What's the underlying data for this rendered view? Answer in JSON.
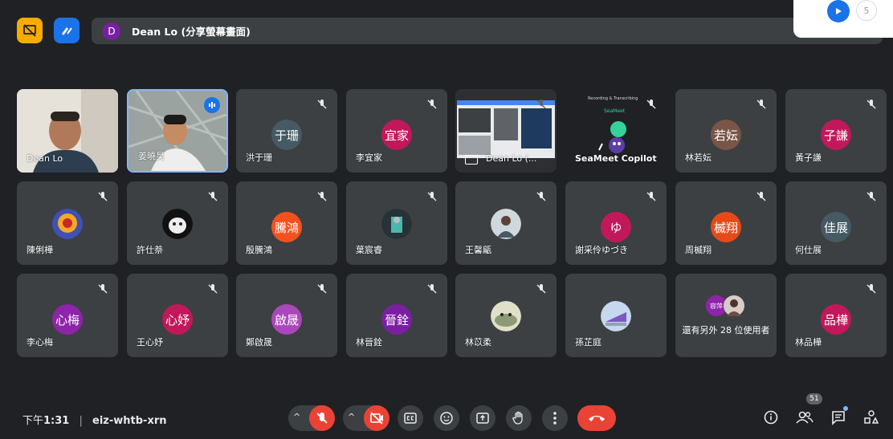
{
  "presenter": {
    "initial": "D",
    "label": "Dean Lo (分享螢幕畫面)"
  },
  "popup": {
    "alt_label": "5"
  },
  "tiles": [
    {
      "id": "dean-lo",
      "name": "Dean Lo"
    },
    {
      "id": "speaker",
      "name": "姜曉昊"
    },
    {
      "id": "t3",
      "name": "洪于珊",
      "initials": "于珊",
      "color": "#455a64"
    },
    {
      "id": "t4",
      "name": "李宜家",
      "initials": "宜家",
      "color": "#c2185b"
    },
    {
      "id": "t5",
      "name": "Dean Lo (..."
    },
    {
      "id": "t6",
      "name": "SeaMeet Copilot",
      "caption": "Recording & Transcribing",
      "brand": "SeaMeet"
    },
    {
      "id": "t7",
      "name": "林若妘",
      "initials": "若妘",
      "color": "#795548"
    },
    {
      "id": "t8",
      "name": "黃子謙",
      "initials": "子謙",
      "color": "#c2185b"
    },
    {
      "id": "t9",
      "name": "陳俐樺"
    },
    {
      "id": "t10",
      "name": "許仕萘"
    },
    {
      "id": "t11",
      "name": "殷騰鴻",
      "initials": "騰鴻",
      "color": "#f4511e"
    },
    {
      "id": "t12",
      "name": "葉宸睿"
    },
    {
      "id": "t13",
      "name": "王馨甂"
    },
    {
      "id": "t14",
      "name": "謝采伶ゆづき",
      "initials": "ゆ",
      "color": "#c2185b"
    },
    {
      "id": "t15",
      "name": "周楲翔",
      "initials": "楲翔",
      "color": "#e64a19"
    },
    {
      "id": "t16",
      "name": "何仕展",
      "initials": "佳展",
      "color": "#455a64"
    },
    {
      "id": "t17",
      "name": "李心梅",
      "initials": "心梅",
      "color": "#8e24aa"
    },
    {
      "id": "t18",
      "name": "王心妤",
      "initials": "心妤",
      "color": "#c2185b"
    },
    {
      "id": "t19",
      "name": "鄭啟晟",
      "initials": "啟晟",
      "color": "#ab47bc"
    },
    {
      "id": "t20",
      "name": "林晉銓",
      "initials": "晉銓",
      "color": "#7b1fa2"
    },
    {
      "id": "t21",
      "name": "林苡柔"
    },
    {
      "id": "t22",
      "name": "孫芷庭"
    },
    {
      "id": "t23",
      "name": "還有另外 28 位使用者",
      "chip": "容萍"
    },
    {
      "id": "t24",
      "name": "林品樺",
      "initials": "品樺",
      "color": "#c2185b"
    }
  ],
  "bottombar": {
    "time_prefix": "下午",
    "time": "1:31",
    "separator": "|",
    "meeting_code": "eiz-whtb-xrn",
    "participants_count": "51"
  },
  "colors": {
    "background": "#202124",
    "tile": "#3c4043",
    "accent": "#1a73e8",
    "danger": "#ea4335"
  }
}
